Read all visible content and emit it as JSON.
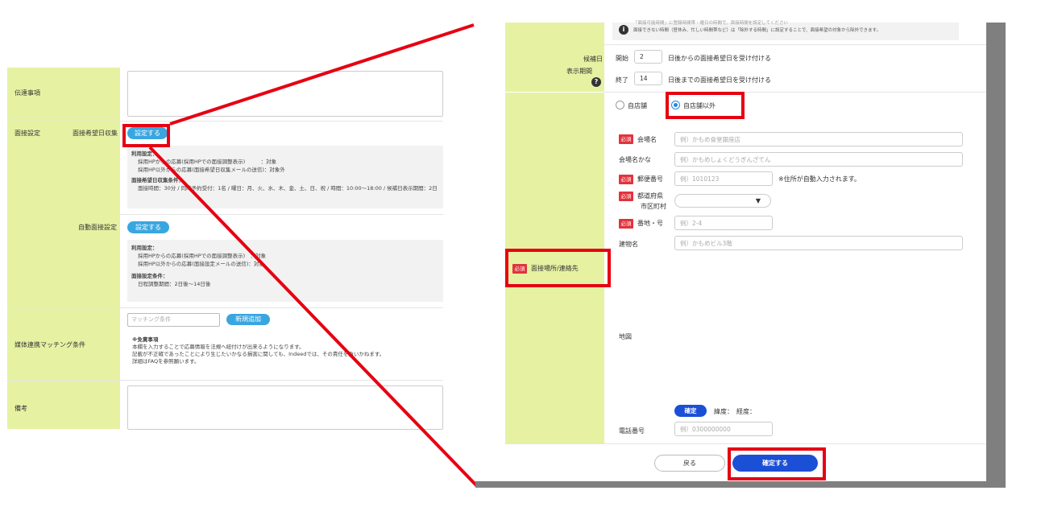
{
  "left": {
    "row_dengon": {
      "label": "伝達事項"
    },
    "row_mensetsu": {
      "label": "面接設定",
      "sub1_label": "面接希望日収集",
      "sub1_button": "設定する",
      "sub1_info": {
        "title1": "利用設定：",
        "line1": "採用HPからの応募(採用HPでの面接調整表示)　　　：対象",
        "line2": "採用HP以外からの応募(面接希望日収集メールの送信)：対象外",
        "title2": "面接希望日収集条件：",
        "line3": "面接時間：30分 / 同時予約受付：1名 / 曜日：月、火、水、木、金、土、日、祝 / 時間：10:00～18:00 / 候補日表示期間：2日"
      },
      "sub2_label": "自動面接設定",
      "sub2_button": "設定する",
      "sub2_info": {
        "title1": "利用設定：",
        "line1": "採用HPからの応募(採用HPでの面接調整表示)　：対象",
        "line2": "採用HP以外からの応募(面接設定メールの送信)：対象",
        "title2": "面接設定条件：",
        "line3": "日程調整期間：2日後～14日後"
      }
    },
    "row_baitai": {
      "label": "媒体連携マッチング条件",
      "input_placeholder": "マッチング条件",
      "add_button": "新規追加",
      "note_title": "※免責事項",
      "note_line1": "本欄を入力することで応募情報を法規へ紐付けが出来るようになります。",
      "note_line2": "記載が不正確であったことにより生じたいかなる損害に関しても、Indeedでは、その責任を負いかねます。",
      "note_line3": "詳細はFAQを参照願います。"
    },
    "row_biko": {
      "label": "備考"
    }
  },
  "modal": {
    "info_text_line1": "「面接可能時間」に登録時間帯・曜日の時間で、面接時間を設定してください",
    "info_text_line2": "面接できない時間（昼休み、忙しい時間帯など）は「除外する時間」に設定することで、面接希望の対象から除外できます。",
    "kohobi": {
      "label_line1": "候補日",
      "label_line2": "表示期間",
      "start_label": "開始",
      "start_value": "2",
      "start_suffix": "日後からの面接希望日を受け付ける",
      "end_label": "終了",
      "end_value": "14",
      "end_suffix": "日後までの面接希望日を受け付ける"
    },
    "place": {
      "label": "面接場所/連絡先",
      "required_badge": "必須",
      "radio_own": "自店舗",
      "radio_other": "自店舗以外",
      "venue_label": "会場名",
      "venue_placeholder": "例）かもめ食堂銀座店",
      "venue_kana_label": "会場名かな",
      "venue_kana_placeholder": "例）かもめしょくどうぎんざてん",
      "zip_label": "郵便番号",
      "zip_placeholder": "例）1010123",
      "zip_note": "※住所が自動入力されます。",
      "pref_label_line1": "都道府県",
      "pref_label_line2": "市区町村",
      "street_label": "番地・号",
      "street_placeholder": "例）2-4",
      "building_label": "建物名",
      "building_placeholder": "例）かもめビル3階",
      "map_label": "地図",
      "confirm_small": "確定",
      "latlng": "緯度：　経度：",
      "phone_label": "電話番号",
      "phone_placeholder": "例）0300000000"
    },
    "back_button": "戻る",
    "confirm_button": "確定する"
  },
  "colors": {
    "label_bg": "#e6f2a2",
    "highlight": "#e60012",
    "primary": "#1b4fd6",
    "link_blue": "#3aa6e0"
  }
}
